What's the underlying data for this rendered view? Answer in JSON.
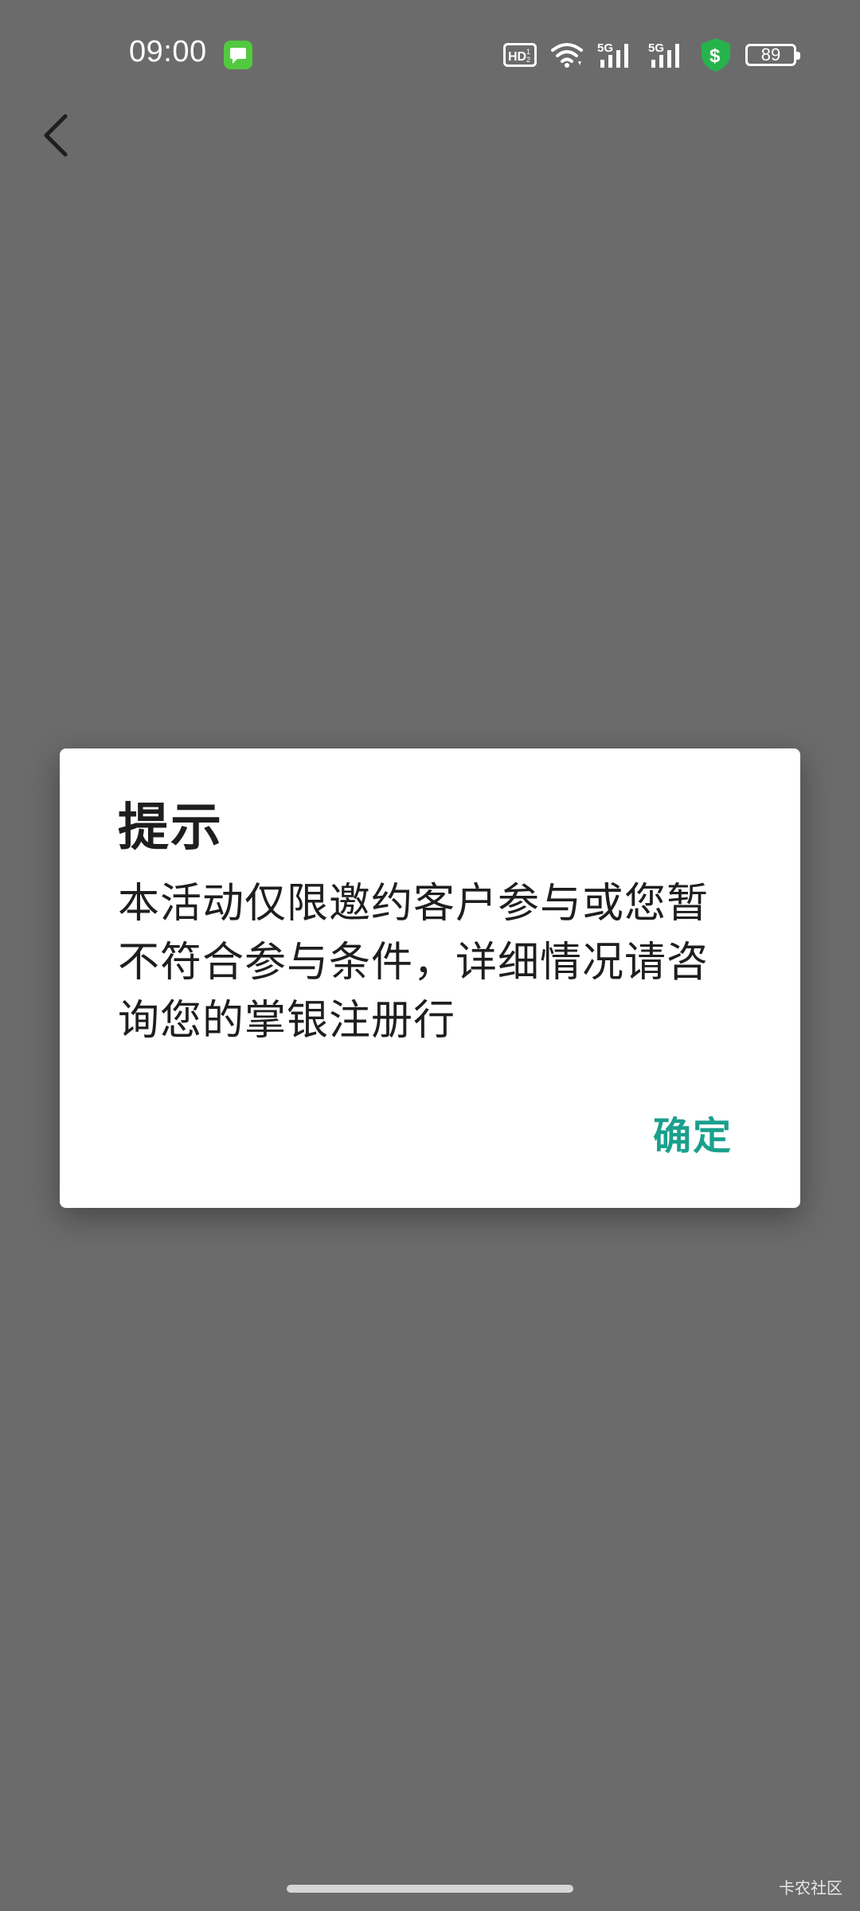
{
  "status_bar": {
    "time": "09:00",
    "battery": "89",
    "icons": [
      "message-app-icon",
      "hd-icon",
      "wifi-icon",
      "5g-signal-icon",
      "5g-signal-icon",
      "security-shield-icon",
      "battery-icon"
    ]
  },
  "nav": {
    "back_icon": "chevron-left-icon"
  },
  "dialog": {
    "title": "提示",
    "message": "本活动仅限邀约客户参与或您暂不符合参与条件，详细情况请咨询您的掌银注册行",
    "confirm_label": "确定"
  },
  "watermark": "卡农社区",
  "colors": {
    "overlay": "#6b6b6b",
    "accent": "#1aa08d",
    "dialog_bg": "#ffffff",
    "message_icon": "#52c93f",
    "shield_icon": "#27b34b"
  }
}
